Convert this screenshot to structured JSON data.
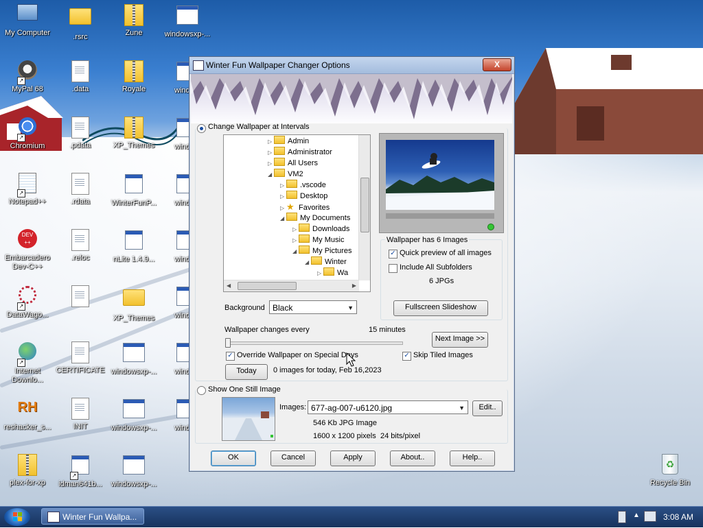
{
  "desktop_icons": [
    {
      "id": "my-computer",
      "label": "My Computer",
      "icon": "computer-icon"
    },
    {
      "id": "rsrc",
      "label": ".rsrc",
      "icon": "folder-icon"
    },
    {
      "id": "zune",
      "label": "Zune",
      "icon": "zip-folder-icon"
    },
    {
      "id": "windowsxp-1",
      "label": "windowsxp-...",
      "icon": "window-icon"
    },
    {
      "id": "mypal",
      "label": "MyPal 68",
      "icon": "raccoon-icon"
    },
    {
      "id": "data",
      "label": ".data",
      "icon": "file-icon"
    },
    {
      "id": "royale",
      "label": "Royale",
      "icon": "zip-folder-icon"
    },
    {
      "id": "windows-2",
      "label": "windo...",
      "icon": "window-icon"
    },
    {
      "id": "chromium",
      "label": "Chromium",
      "icon": "chromium-icon"
    },
    {
      "id": "pdata",
      "label": ".pdata",
      "icon": "file-icon"
    },
    {
      "id": "xp-themes-1",
      "label": "XP_Themes",
      "icon": "zip-folder-icon"
    },
    {
      "id": "windows-3",
      "label": "windo...",
      "icon": "window-icon"
    },
    {
      "id": "notepad",
      "label": "Notepad++",
      "icon": "notepad-icon"
    },
    {
      "id": "rdata",
      "label": ".rdata",
      "icon": "file-icon"
    },
    {
      "id": "winterfun",
      "label": "WinterFunP...",
      "icon": "installer-icon"
    },
    {
      "id": "windows-4",
      "label": "windo...",
      "icon": "window-icon"
    },
    {
      "id": "devcpp",
      "label": "Embarcadero Dev-C++",
      "icon": "devcpp-icon"
    },
    {
      "id": "reloc",
      "label": ".reloc",
      "icon": "file-icon"
    },
    {
      "id": "nlite",
      "label": "nLite 1.4.9...",
      "icon": "installer-icon"
    },
    {
      "id": "windows-5",
      "label": "windo...",
      "icon": "window-icon"
    },
    {
      "id": "datawago",
      "label": "DataWago...",
      "icon": "datawago-icon"
    },
    {
      "id": "text-doc",
      "label": "",
      "icon": "text-file-icon"
    },
    {
      "id": "xp-themes-2",
      "label": "XP_Themes",
      "icon": "folder-icon"
    },
    {
      "id": "windows-6",
      "label": "windo...",
      "icon": "window-icon"
    },
    {
      "id": "idm",
      "label": "Internet Downlo...",
      "icon": "idm-icon"
    },
    {
      "id": "certificate",
      "label": "CERTIFICATE",
      "icon": "file-icon"
    },
    {
      "id": "windowsxp-7",
      "label": "windowsxp-...",
      "icon": "window-icon"
    },
    {
      "id": "windows-8",
      "label": "windo...",
      "icon": "window-icon"
    },
    {
      "id": "reshacker",
      "label": "reshacker_s...",
      "icon": "reshacker-icon"
    },
    {
      "id": "init",
      "label": "INIT",
      "icon": "file-icon"
    },
    {
      "id": "windowsxp-9",
      "label": "windowsxp-...",
      "icon": "window-icon"
    },
    {
      "id": "windows-10",
      "label": "windo...",
      "icon": "window-icon"
    },
    {
      "id": "plex",
      "label": "plex-for-xp",
      "icon": "zip-folder-icon"
    },
    {
      "id": "idman",
      "label": "idman641b...",
      "icon": "installer-icon"
    },
    {
      "id": "windowsxp-11",
      "label": "windowsxp-...",
      "icon": "window-icon"
    },
    {
      "id": "recycle",
      "label": "Recycle Bin",
      "icon": "recycle-bin-icon"
    }
  ],
  "dialog": {
    "title": "Winter Fun Wallpaper Changer Options",
    "close_label": "X",
    "interval_radio_label": "Change Wallpaper at Intervals",
    "interval_selected": true,
    "tree": [
      {
        "label": "Admin",
        "expander": "▷",
        "icon": "folder"
      },
      {
        "label": "Administrator",
        "expander": "▷",
        "icon": "folder"
      },
      {
        "label": "All Users",
        "expander": "▷",
        "icon": "folder"
      },
      {
        "label": "VM2",
        "expander": "◢",
        "icon": "folder"
      },
      {
        "label": ".vscode",
        "expander": "▷",
        "icon": "folder"
      },
      {
        "label": "Desktop",
        "expander": "▷",
        "icon": "folder"
      },
      {
        "label": "Favorites",
        "expander": "▷",
        "icon": "star"
      },
      {
        "label": "My Documents",
        "expander": "◢",
        "icon": "folder"
      },
      {
        "label": "Downloads",
        "expander": "▷",
        "icon": "folder"
      },
      {
        "label": "My Music",
        "expander": "▷",
        "icon": "folder"
      },
      {
        "label": "My Pictures",
        "expander": "◢",
        "icon": "folder"
      },
      {
        "label": "Winter",
        "expander": "◢",
        "icon": "folder"
      },
      {
        "label": "Wa",
        "expander": "▷",
        "icon": "folder"
      }
    ],
    "background_label": "Background",
    "background_value": "Black",
    "wallpaper_count_label": "Wallpaper has 6 Images",
    "quick_preview_label": "Quick preview of all images",
    "quick_preview_checked": true,
    "include_subfolders_label": "Include All Subfolders",
    "include_subfolders_checked": false,
    "jpg_count": "6 JPGs",
    "fullscreen_label": "Fullscreen Slideshow",
    "changes_every_label": "Wallpaper changes every",
    "interval_value": "15 minutes",
    "interval_slider_fraction": 0,
    "next_image_label": "Next Image >>",
    "override_label": "Override Wallpaper on Special Days",
    "override_checked": true,
    "skip_tiled_label": "Skip Tiled Images",
    "skip_tiled_checked": true,
    "today_label": "Today",
    "today_status": "0 images for today, Feb 16,2023",
    "still_radio_label": "Show One Still Image",
    "still_selected": false,
    "images_label": "Images:",
    "images_value": "677-ag-007-u6120.jpg",
    "edit_label": "Edit..",
    "image_size": "546 Kb  JPG Image",
    "image_dims": "1600 x 1200 pixels",
    "image_depth": "24 bits/pixel",
    "buttons": {
      "ok": "OK",
      "cancel": "Cancel",
      "apply": "Apply",
      "about": "About..",
      "help": "Help.."
    }
  },
  "taskbar": {
    "window_label": "Winter Fun Wallpa...",
    "clock": "3:08 AM"
  }
}
